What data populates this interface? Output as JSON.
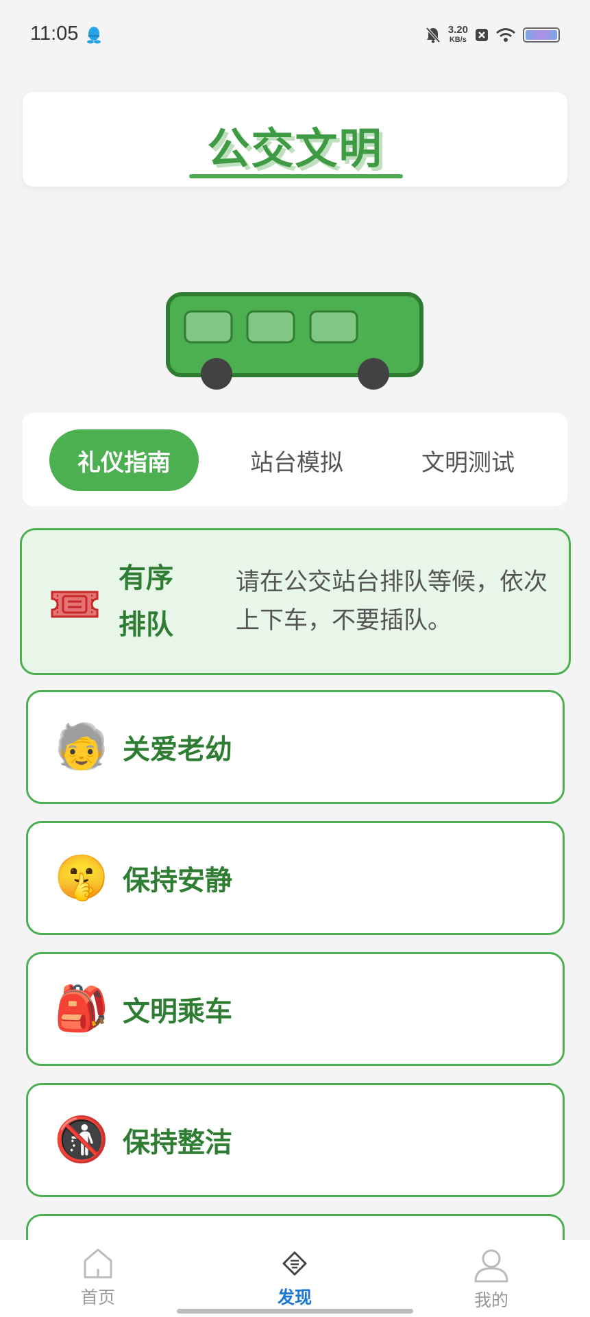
{
  "status_bar": {
    "time": "11:05",
    "speed_value": "3.20",
    "speed_unit": "KB/s",
    "icons": [
      "qq-penguin-icon",
      "mute-bell-icon",
      "x-box-icon",
      "wifi-icon",
      "battery-icon"
    ]
  },
  "header": {
    "title": "公交文明"
  },
  "tabs": [
    {
      "label": "礼仪指南",
      "active": true
    },
    {
      "label": "站台模拟",
      "active": false
    },
    {
      "label": "文明测试",
      "active": false
    }
  ],
  "cards": [
    {
      "icon": "ticket-icon",
      "label": "有序排队",
      "description": "请在公交站台排队等候，依次上下车，不要插队。",
      "expanded": true
    },
    {
      "icon": "older-person-icon",
      "emoji": "🧓",
      "label": "关爱老幼"
    },
    {
      "icon": "shushing-face-icon",
      "emoji": "🤫",
      "label": "保持安静"
    },
    {
      "icon": "backpack-icon",
      "emoji": "🎒",
      "label": "文明乘车"
    },
    {
      "icon": "no-littering-icon",
      "emoji": "🚯",
      "label": "保持整洁"
    }
  ],
  "bottom_nav": [
    {
      "label": "首页",
      "icon": "home-icon",
      "active": false
    },
    {
      "label": "发现",
      "icon": "discover-icon",
      "active": true
    },
    {
      "label": "我的",
      "icon": "user-icon",
      "active": false
    }
  ],
  "colors": {
    "primary_green": "#4caf50",
    "dark_green": "#2e7d32",
    "card_highlight": "#e8f5e9",
    "nav_active": "#1976d2"
  }
}
